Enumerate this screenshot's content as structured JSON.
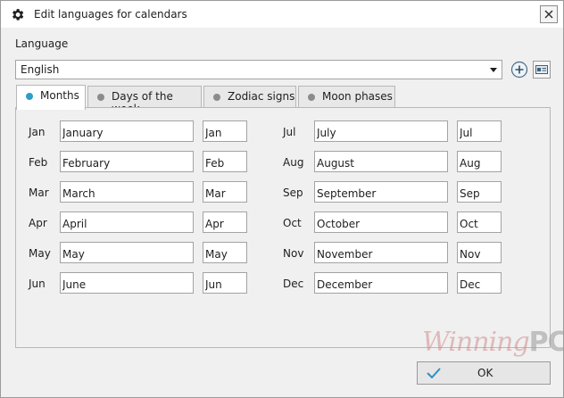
{
  "window": {
    "title": "Edit languages for calendars",
    "title_icon": "gear-icon",
    "close_icon": "close-icon"
  },
  "language": {
    "label": "Language",
    "selected": "English",
    "add_icon": "add-circle-icon",
    "edit_icon": "id-card-icon"
  },
  "tabs": [
    {
      "label": "Months",
      "active": true
    },
    {
      "label": "Days of the week",
      "active": false
    },
    {
      "label": "Zodiac signs",
      "active": false
    },
    {
      "label": "Moon phases",
      "active": false
    }
  ],
  "months": [
    {
      "abbr_label": "Jan",
      "name": "January",
      "short": "Jan"
    },
    {
      "abbr_label": "Feb",
      "name": "February",
      "short": "Feb"
    },
    {
      "abbr_label": "Mar",
      "name": "March",
      "short": "Mar"
    },
    {
      "abbr_label": "Apr",
      "name": "April",
      "short": "Apr"
    },
    {
      "abbr_label": "May",
      "name": "May",
      "short": "May"
    },
    {
      "abbr_label": "Jun",
      "name": "June",
      "short": "Jun"
    },
    {
      "abbr_label": "Jul",
      "name": "July",
      "short": "Jul"
    },
    {
      "abbr_label": "Aug",
      "name": "August",
      "short": "Aug"
    },
    {
      "abbr_label": "Sep",
      "name": "September",
      "short": "Sep"
    },
    {
      "abbr_label": "Oct",
      "name": "October",
      "short": "Oct"
    },
    {
      "abbr_label": "Nov",
      "name": "November",
      "short": "Nov"
    },
    {
      "abbr_label": "Dec",
      "name": "December",
      "short": "Dec"
    }
  ],
  "watermark": {
    "text": "Winning",
    "suffix": "PC"
  },
  "ok_button": {
    "label": "OK",
    "icon": "check-icon"
  },
  "colors": {
    "active_tab_dot": "#2c9ec7",
    "inactive_tab_dot": "#8c8c8c",
    "check": "#2c8fc9"
  }
}
